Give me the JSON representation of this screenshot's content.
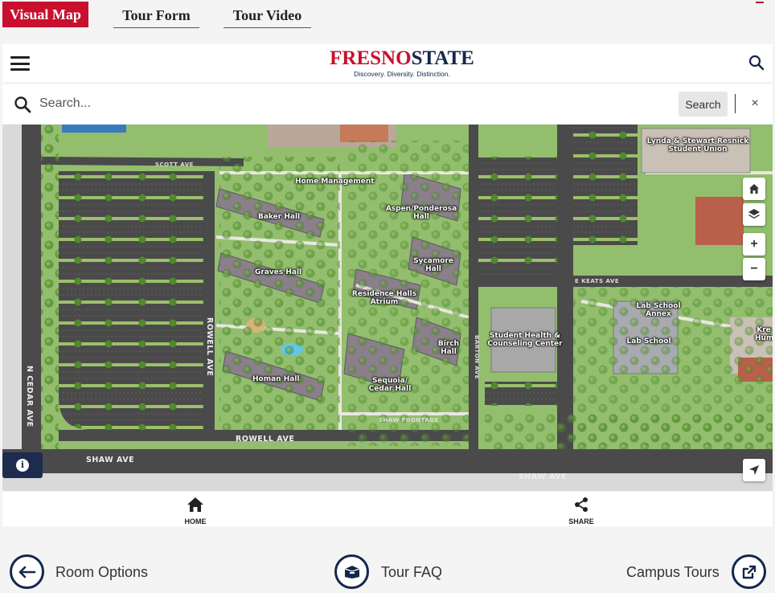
{
  "tabs": {
    "active": "Visual Map",
    "tour_form": "Tour Form",
    "tour_video": "Tour Video"
  },
  "header": {
    "logo_fresno": "FRESNO",
    "logo_state": "STATE",
    "logo_tagline": "Discovery. Diversity. Distinction."
  },
  "search": {
    "placeholder": "Search...",
    "button_label": "Search",
    "clear_label": "×"
  },
  "map": {
    "buildings": [
      "Home Management",
      "Baker Hall",
      "Graves Hall",
      "Homan Hall",
      "Aspen/Ponderosa Hall",
      "Sycamore Hall",
      "Residence Halls Atrium",
      "Birch Hall",
      "Sequoia/ Cedar Hall",
      "Student Health & Counseling Center",
      "Lynda & Stewart Resnick Student Union",
      "Lab School Annex",
      "Lab School",
      "Kre Hum"
    ],
    "streets": {
      "scott": "SCOTT AVE",
      "rowell_vertical": "ROWELL AVE",
      "rowell": "ROWELL AVE",
      "cedar": "N CEDAR AVE",
      "shaw_left": "SHAW AVE",
      "shaw_right": "SHAW AVE",
      "shaw_frontage": "SHAW FRONTAGE",
      "barton": "BARTON AVE",
      "keats": "E KEATS AVE"
    },
    "controls": {
      "zoom_in": "+",
      "zoom_out": "−"
    }
  },
  "bottom_nav": {
    "home": "HOME",
    "share": "SHARE"
  },
  "footer": {
    "room_options": "Room Options",
    "tour_faq": "Tour FAQ",
    "campus_tours": "Campus Tours"
  },
  "colors": {
    "brand_red": "#c8102e",
    "brand_navy": "#13284c"
  }
}
